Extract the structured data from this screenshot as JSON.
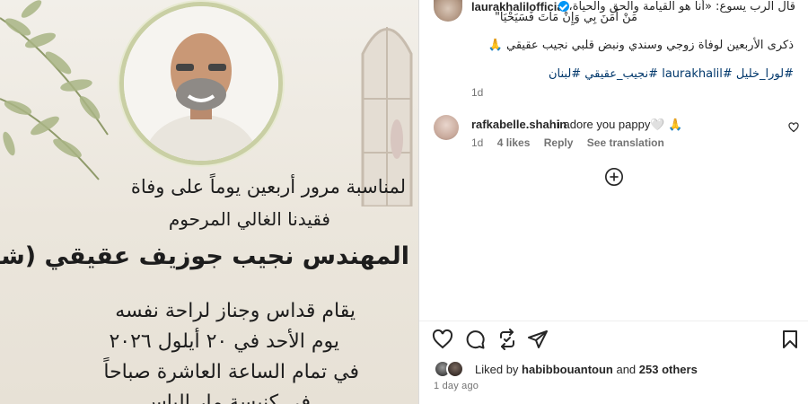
{
  "post_image": {
    "announcement": {
      "line1": "لمناسبة مرور أربعين يوماً على وفاة",
      "line2": "فقيدنا الغالي المرحوم",
      "line3": "المهندس نجيب جوزيف عقيقي (شاهين)",
      "line4": "يقام قداس وجناز لراحة نفسه",
      "line5": "يوم الأحد في ٢٠ أيلول ٢٠٢٦",
      "line6": "في تمام الساعة العاشرة صباحاً",
      "line7": "في كنيسة مار الياس"
    }
  },
  "caption": {
    "username": "laurakhalilofficial",
    "verified": true,
    "line1": "قال الرب يسوع: «أنا هو القيامة والحق والحياة،",
    "line2": "مَنْ آمَنَ بِي وَإِنْ مَاتَ فَسَيَحْيَا\"",
    "line3": "ذكرى الأربعين لوفاة زوجي وسندي ونبض قلبي نجيب عقيقي 🙏",
    "hashtags": "#لورا_خليل #laurakhalil #نجيب_عقيقي #لبنان",
    "age": "1d"
  },
  "comments": [
    {
      "username": "rafkabelle.shahin",
      "text": "i adore you pappy🤍 🙏",
      "age": "1d",
      "likes": "4 likes",
      "reply_label": "Reply",
      "translate_label": "See translation"
    }
  ],
  "actions": {
    "like_icon": "heart-icon",
    "comment_icon": "comment-icon",
    "repost_icon": "repost-icon",
    "share_icon": "share-icon",
    "save_icon": "bookmark-icon"
  },
  "likes": {
    "prefix": "Liked by ",
    "user": "habibbouantoun",
    "connector": " and ",
    "others": "253 others"
  },
  "post_age": "1 day ago",
  "colors": {
    "accent": "#0095f6",
    "hashtag": "#00376b",
    "muted": "#737373",
    "text": "#262626"
  }
}
